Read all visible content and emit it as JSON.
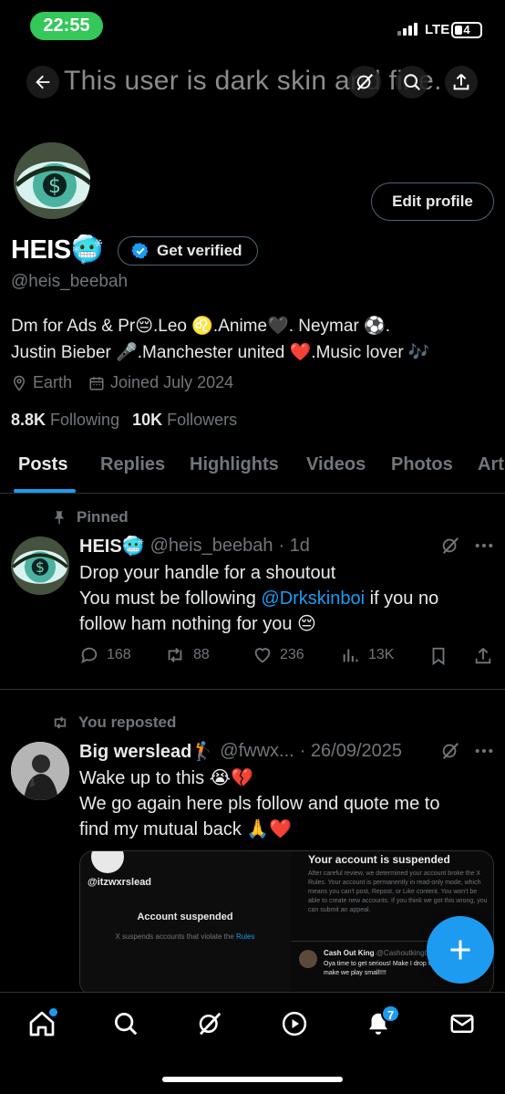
{
  "status_bar": {
    "time": "22:55",
    "network": "LTE",
    "battery": "4"
  },
  "topnav": {
    "title": "This user is dark skin and fine."
  },
  "profile": {
    "name": "HEIS🥶",
    "verify_label": "Get verified",
    "handle": "@heis_beebah",
    "edit_label": "Edit profile",
    "bio_line1": "Dm for Ads & Pr😔.Leo ♌️.Anime🖤. Neymar ⚽️.",
    "bio_line2": "Justin Bieber 🎤.Manchester united ❤️.Music lover 🎶",
    "location": "Earth",
    "joined": "Joined July 2024",
    "following_count": "8.8K",
    "following_label": "Following",
    "followers_count": "10K",
    "followers_label": "Followers"
  },
  "tabs": [
    "Posts",
    "Replies",
    "Highlights",
    "Videos",
    "Photos",
    "Articles"
  ],
  "posts": [
    {
      "context": "Pinned",
      "name": "HEIS🥶",
      "handle": "@heis_beebah",
      "time": "· 1d",
      "line1": "Drop your handle for a shoutout",
      "line2_pre": "You must be following ",
      "line2_mention": "@Drkskinboi",
      "line2_post": " if you no",
      "line3": "follow ham nothing for you 😔",
      "replies": "168",
      "reposts": "88",
      "likes": "236",
      "views": "13K"
    },
    {
      "context": "You reposted",
      "name": "Big werslead🏌️",
      "handle": "@fwwx...",
      "time": "· 26/09/2025",
      "line1": "Wake up to this 😭💔",
      "line2": "We go again here pls follow and quote me to",
      "line3": "find my mutual back 🙏❤️"
    }
  ],
  "media": {
    "left_handle": "@itzwxrslead",
    "left_title": "Account suspended",
    "left_sub_pre": "X suspends accounts that violate the ",
    "left_sub_link": "Rules",
    "right_title": "Your account is suspended",
    "right_body": "After careful review, we determined your account broke the X Rules. Your account is permanently in read-only mode, which means you can't post, Repost, or Like content. You won't be able to create new accounts. If you think we got this wrong, you can submit an appeal.",
    "right_post_name": "Cash Out King",
    "right_post_handle": "@Cashoutkingbo",
    "right_post_text": "Oya time to get serious! Make I drop want make we play small!!!!"
  },
  "tabbar": {
    "notifications_badge": "7"
  },
  "colors": {
    "accent": "#1d9bf0",
    "status_green": "#34c759",
    "muted": "#71767b",
    "divider": "#2f3336"
  }
}
